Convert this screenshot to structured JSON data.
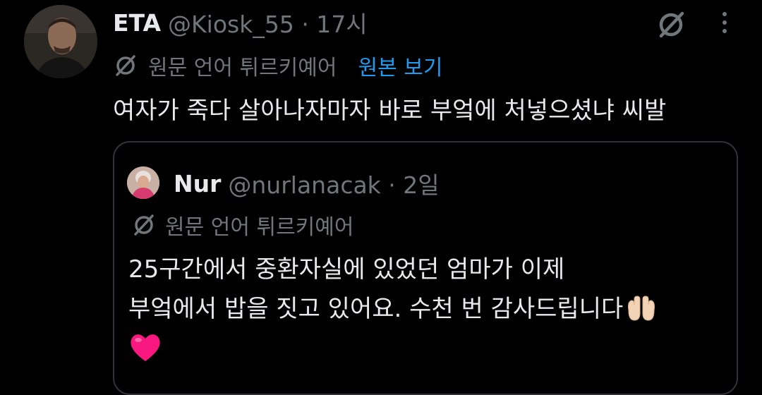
{
  "tweet": {
    "author": {
      "display_name": "ETA",
      "handle_meta": "@Kiosk_55 · 17시",
      "avatar_icon": "man-portrait-avatar"
    },
    "grok_icon": "grok-icon",
    "more_icon": "more-vertical-icon",
    "translation": {
      "icon": "translate-icon",
      "label": "원문 언어 튀르키예어",
      "show_original": "원본 보기"
    },
    "text": "여자가 죽다 살아나자마자 바로 부엌에 처넣으셨냐 씨발"
  },
  "quoted_tweet": {
    "author": {
      "display_name": "Nur",
      "handle_meta": "@nurlanacak · 2일",
      "avatar_icon": "woman-portrait-avatar"
    },
    "translation": {
      "icon": "translate-icon",
      "label": "원문 언어 튀르키예어"
    },
    "lines": [
      "25구간에서 중환자실에 있었던 엄마가 이제",
      "부엌에서 밥을 짓고 있어요. 수천 번 감사드립니다"
    ],
    "emoji_1": "palms-up-together-emoji",
    "emoji_2": "red-heart-emoji"
  },
  "colors": {
    "background": "#000000",
    "text_primary": "#e7e9ea",
    "text_secondary": "#71767b",
    "link": "#1d9bf0",
    "border": "#2f3336",
    "heart": "#f91880"
  }
}
